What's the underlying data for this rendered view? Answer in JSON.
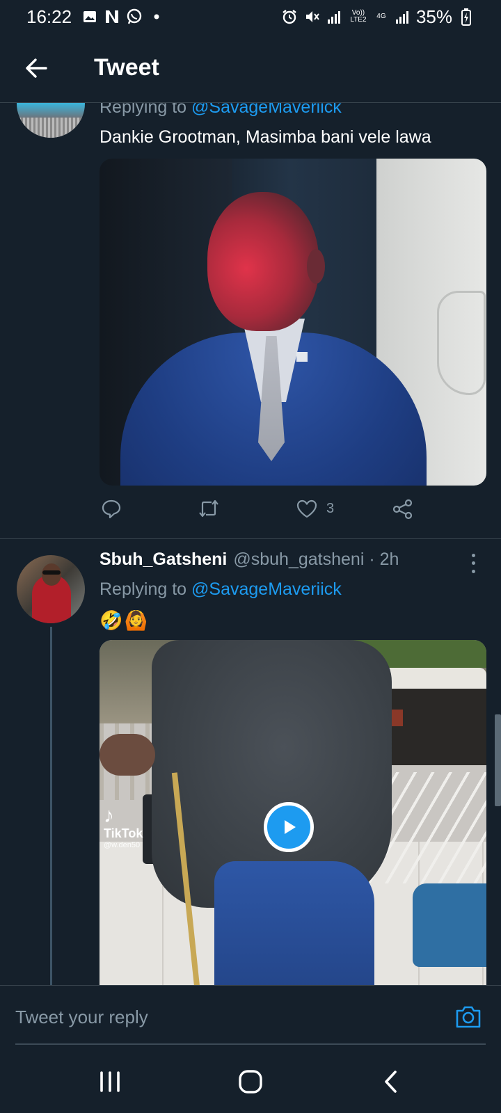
{
  "status_bar": {
    "time": "16:22",
    "network_volte": "Vo)) LTE2",
    "network_type": "4G",
    "battery_percent": "35%"
  },
  "header": {
    "title": "Tweet"
  },
  "tweets": [
    {
      "replying_prefix": "Replying to ",
      "replying_handle": "@SavageMaveriick",
      "text": "Dankie Grootman, Masimba bani vele lawa",
      "like_count": "3"
    },
    {
      "display_name": "Sbuh_Gatsheni",
      "meta": "@sbuh_gatsheni · 2h",
      "replying_prefix": "Replying to ",
      "replying_handle": "@SavageMaveriick",
      "emoji": [
        "🤣",
        "🙆"
      ],
      "video_overlay": {
        "brand": "TikTok",
        "username": "@w.den50"
      }
    }
  ],
  "composer": {
    "placeholder": "Tweet your reply"
  },
  "colors": {
    "background": "#15202b",
    "accent": "#1d9bf0",
    "secondary_text": "#8899a6",
    "divider": "#38444d"
  },
  "icons": {
    "back": "arrow-left-icon",
    "reply": "comment-icon",
    "retweet": "retweet-icon",
    "like": "heart-icon",
    "share": "share-icon",
    "more": "more-vertical-icon",
    "camera": "camera-icon",
    "play": "play-icon"
  }
}
